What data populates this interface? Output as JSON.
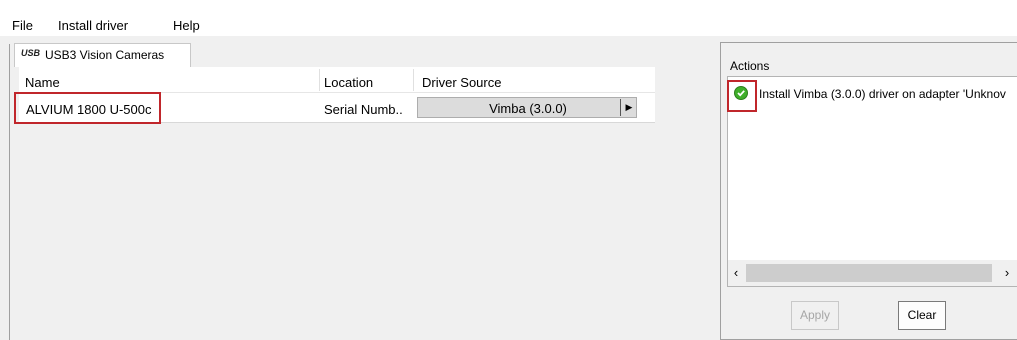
{
  "menu": {
    "items": [
      {
        "label": "File"
      },
      {
        "label": "Install driver"
      },
      {
        "label": "Help"
      }
    ]
  },
  "tab": {
    "icon_text": "USB",
    "icon": "usb-icon",
    "label": "USB3 Vision Cameras"
  },
  "table": {
    "columns": [
      "Name",
      "Location",
      "Driver Source"
    ],
    "rows": [
      {
        "name": "ALVIUM 1800 U-500c",
        "location": "Serial Numb..",
        "driver_source": "Vimba (3.0.0)"
      }
    ]
  },
  "actions": {
    "label": "Actions",
    "items": [
      {
        "text": "Install Vimba (3.0.0) driver on adapter 'Unknov",
        "icon": "check-icon"
      }
    ]
  },
  "buttons": {
    "apply": "Apply",
    "clear": "Clear"
  },
  "colors": {
    "highlight": "#c0262b",
    "check_green": "#3fae2a"
  }
}
